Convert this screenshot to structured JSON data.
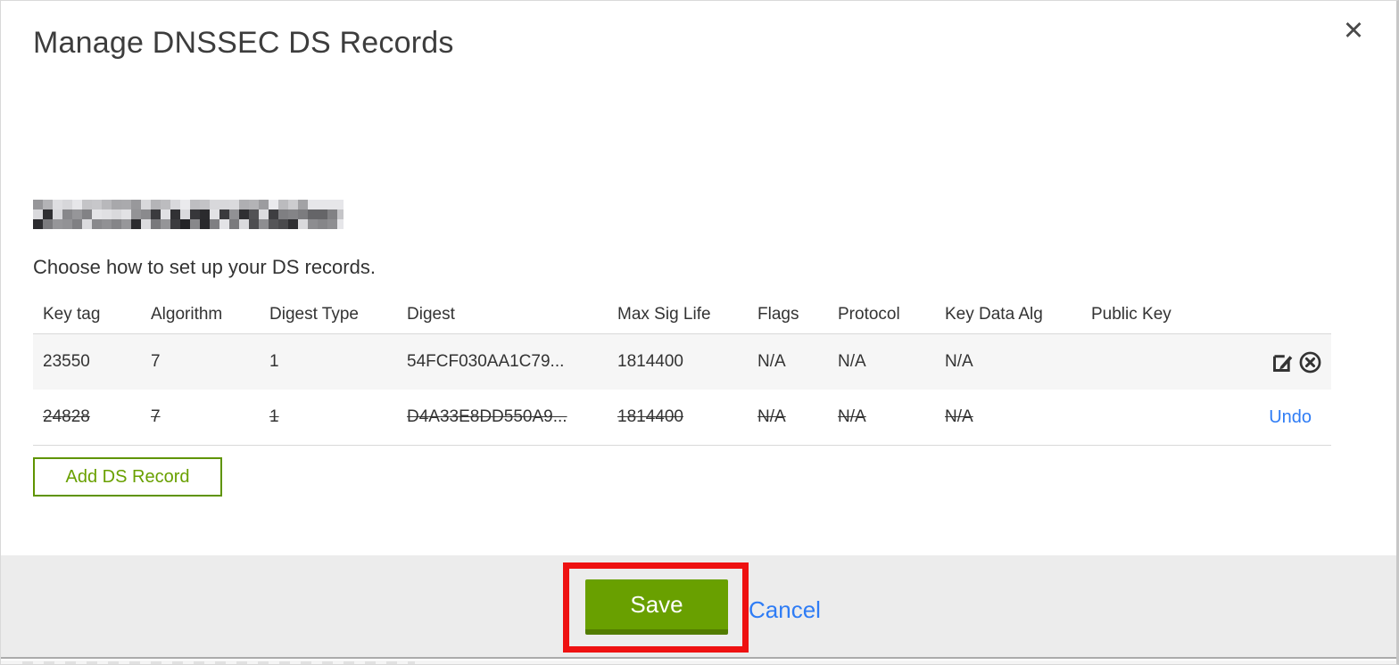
{
  "dialog": {
    "title": "Manage DNSSEC DS Records",
    "close_glyph": "✕",
    "instruction": "Choose how to set up your DS records."
  },
  "table": {
    "columns": [
      "Key tag",
      "Algorithm",
      "Digest Type",
      "Digest",
      "Max Sig Life",
      "Flags",
      "Protocol",
      "Key Data Alg",
      "Public Key"
    ],
    "rows": [
      {
        "key_tag": "23550",
        "algorithm": "7",
        "digest_type": "1",
        "digest": "54FCF030AA1C79...",
        "max_sig_life": "1814400",
        "flags": "N/A",
        "protocol": "N/A",
        "key_data_alg": "N/A",
        "public_key": "",
        "state": "normal"
      },
      {
        "key_tag": "24828",
        "algorithm": "7",
        "digest_type": "1",
        "digest": "D4A33E8DD550A9...",
        "max_sig_life": "1814400",
        "flags": "N/A",
        "protocol": "N/A",
        "key_data_alg": "N/A",
        "public_key": "",
        "state": "deleted",
        "action_label": "Undo"
      }
    ]
  },
  "buttons": {
    "add_ds_record": "Add DS Record",
    "save": "Save",
    "cancel": "Cancel"
  },
  "colors": {
    "accent_green": "#69a000",
    "accent_green_border": "#5f9400",
    "link_blue": "#2e7cf5",
    "annotation_red": "#ee1111",
    "footer_gray": "#ececec",
    "row_stripe_gray": "#f6f6f6"
  }
}
